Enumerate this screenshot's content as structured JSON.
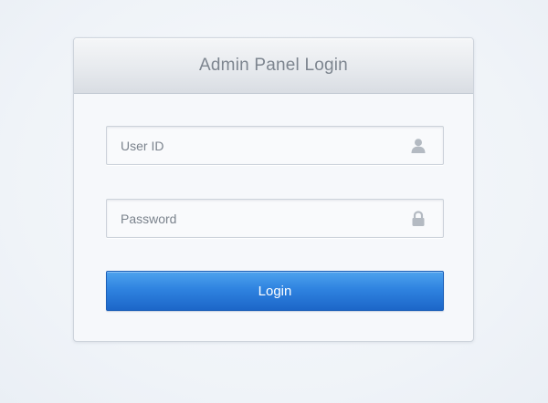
{
  "panel": {
    "title": "Admin Panel Login"
  },
  "form": {
    "user_id": {
      "placeholder": "User ID",
      "value": "",
      "icon": "user-icon"
    },
    "password": {
      "placeholder": "Password",
      "value": "",
      "icon": "lock-icon"
    },
    "login_label": "Login"
  },
  "colors": {
    "background": "#f2f5f9",
    "panel_header_top": "#f5f6f8",
    "panel_header_bottom": "#d9dde3",
    "title_text": "#7d858f",
    "icon": "#b4bac2",
    "button_top": "#4ea3ee",
    "button_bottom": "#1c66c8",
    "button_text": "#ffffff"
  }
}
